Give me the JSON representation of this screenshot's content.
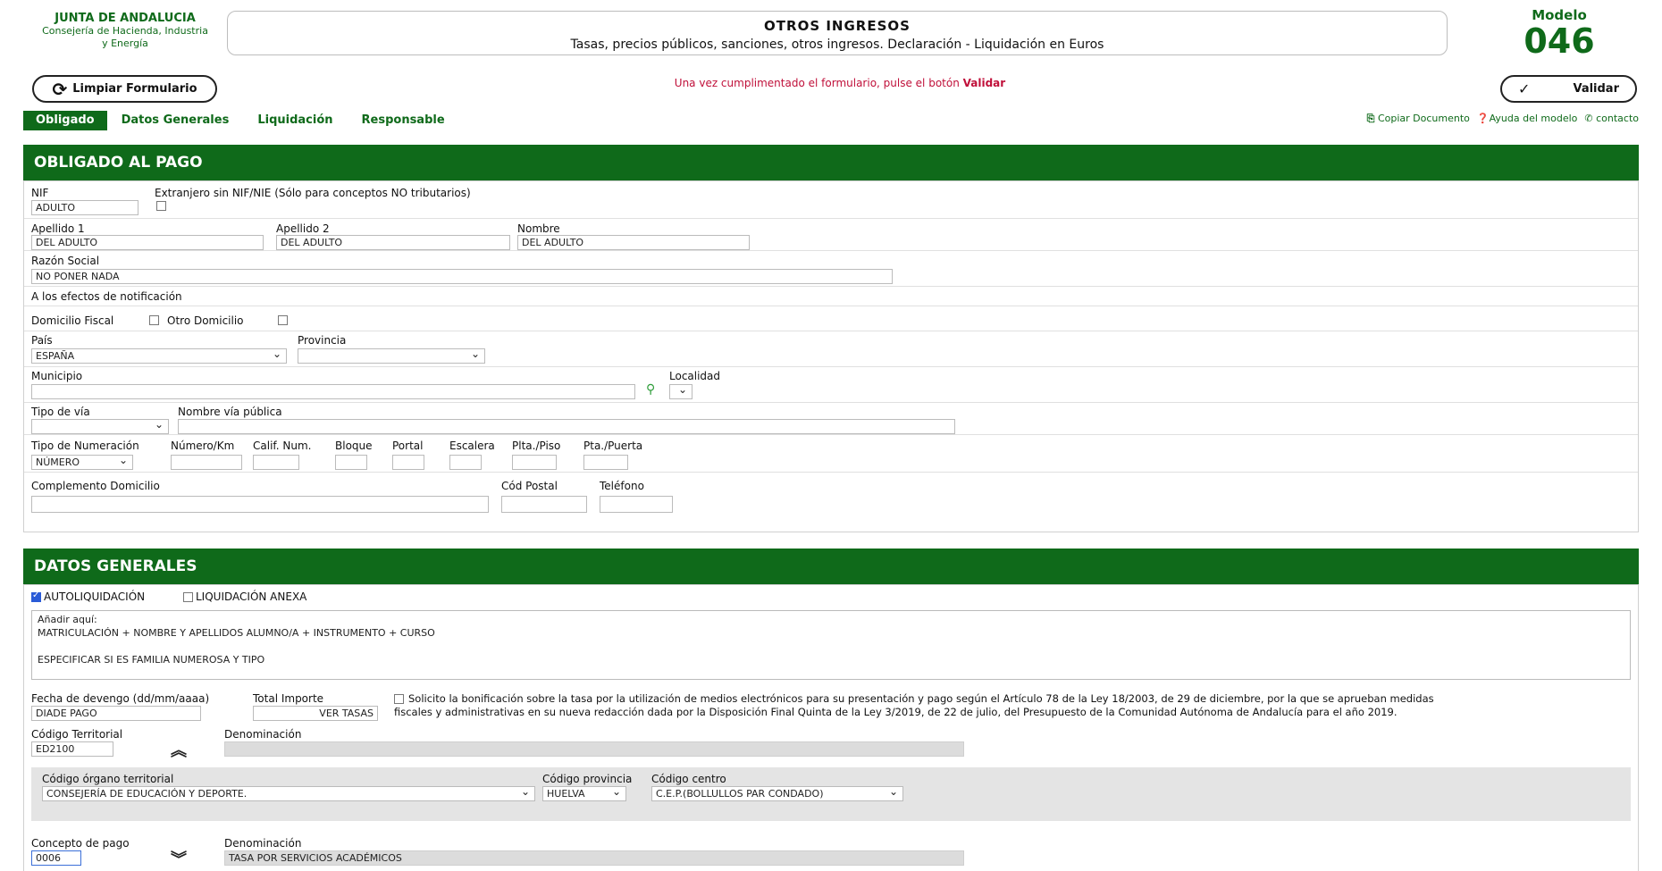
{
  "header": {
    "logo_line1": "JUNTA DE ANDALUCIA",
    "logo_line2": "Consejería de Hacienda, Industria",
    "logo_line3": "y Energía",
    "title": "OTROS INGRESOS",
    "subtitle": "Tasas, precios públicos, sanciones, otros ingresos. Declaración - Liquidación en Euros",
    "modelo_label": "Modelo",
    "modelo_number": "046"
  },
  "toolbar": {
    "clear_label": "Limpiar Formulario",
    "notice_prefix": "Una vez cumplimentado el formulario, pulse el botón",
    "notice_bold": "Validar",
    "validate_label": "Validar"
  },
  "tabs": [
    "Obligado",
    "Datos Generales",
    "Liquidación",
    "Responsable"
  ],
  "doclinks": {
    "copy": "Copiar Documento",
    "help": "Ayuda del modelo",
    "contact": "contacto"
  },
  "obligado": {
    "section_title": "OBLIGADO AL PAGO",
    "nif_label": "NIF",
    "nif_value": "ADULTO",
    "extranjero_label": "Extranjero sin NIF/NIE (Sólo para conceptos NO tributarios)",
    "apellido1_label": "Apellido 1",
    "apellido1_value": "DEL ADULTO",
    "apellido2_label": "Apellido 2",
    "apellido2_value": "DEL ADULTO",
    "nombre_label": "Nombre",
    "nombre_value": "DEL ADULTO",
    "razon_label": "Razón Social",
    "razon_value": "NO PONER NADA",
    "notif_label": "A los efectos de notificación",
    "domicilio_fiscal_label": "Domicilio Fiscal",
    "otro_domicilio_label": "Otro Domicilio",
    "pais_label": "País",
    "pais_value": "ESPAÑA",
    "provincia_label": "Provincia",
    "municipio_label": "Municipio",
    "localidad_label": "Localidad",
    "tipovia_label": "Tipo de vía",
    "nombrevia_label": "Nombre vía pública",
    "tiponum_label": "Tipo de Numeración",
    "tiponum_value": "NÚMERO",
    "numero_label": "Número/Km",
    "calif_label": "Calif. Num.",
    "bloque_label": "Bloque",
    "portal_label": "Portal",
    "escalera_label": "Escalera",
    "planta_label": "Plta./Piso",
    "puerta_label": "Pta./Puerta",
    "complemento_label": "Complemento Domicilio",
    "cp_label": "Cód Postal",
    "telefono_label": "Teléfono"
  },
  "generales": {
    "section_title": "DATOS GENERALES",
    "autoliq_label": "AUTOLIQUIDACIÓN",
    "liqanexa_label": "LIQUIDACIÓN ANEXA",
    "textarea_value": "Añadir aquí:\nMATRICULACIÓN + NOMBRE Y APELLIDOS ALUMNO/A + INSTRUMENTO + CURSO\n\nESPECIFICAR SI ES FAMILIA NUMEROSA Y TIPO",
    "fecha_label": "Fecha de devengo (dd/mm/aaaa)",
    "fecha_value": "DIADE PAGO",
    "total_label": "Total Importe",
    "total_value": "VER TASAS",
    "bonif_text_1": "Solicito la bonificación sobre la tasa por la utilización de medios electrónicos para su presentación y pago según el Artículo 78 de la Ley 18/2003, de 29 de diciembre, por la que se aprueban medidas",
    "bonif_text_2": "fiscales y administrativas en su nueva redacción dada por la Disposición Final Quinta de la Ley 3/2019, de 22 de julio, del Presupuesto de la Comunidad Autónoma de Andalucía para el año 2019.",
    "codterr_label": "Código Territorial",
    "codterr_value": "ED2100",
    "denom1_label": "Denominación",
    "organo_label": "Código órgano territorial",
    "organo_value": "CONSEJERÍA DE EDUCACIÓN Y DEPORTE.",
    "provincia_label": "Código provincia",
    "provincia_value": "HUELVA",
    "centro_label": "Código centro",
    "centro_value": "C.E.P.(BOLLULLOS PAR CONDADO)",
    "concepto_label": "Concepto de pago",
    "concepto_value": "0006",
    "denom2_label": "Denominación",
    "denom2_value": "TASA POR SERVICIOS ACADÉMICOS"
  }
}
